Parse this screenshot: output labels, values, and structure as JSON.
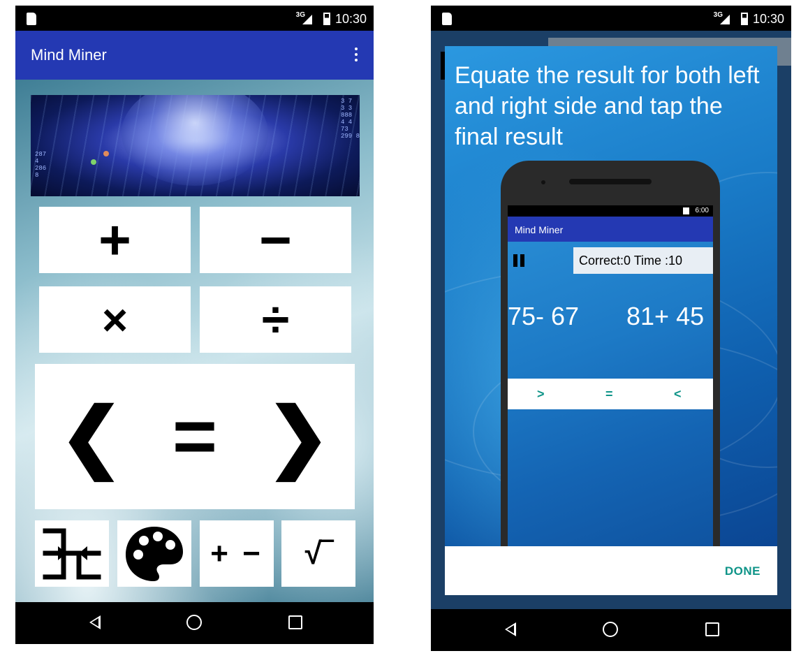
{
  "phone_left": {
    "status_bar": {
      "network": "3G",
      "time": "10:30"
    },
    "app_bar": {
      "title": "Mind Miner"
    },
    "operations": {
      "plus": "+",
      "minus": "−",
      "multiply": "×",
      "divide": "÷"
    },
    "compare": {
      "less": "❮",
      "equals": "=",
      "greater": "❯"
    },
    "tools": {
      "plus_minus": "+ −",
      "root": "√‾"
    }
  },
  "phone_right": {
    "status_bar": {
      "network": "3G",
      "time": "10:30"
    },
    "dialog": {
      "title": "Equate the result for both left and right side and tap the final result",
      "done_label": "DONE"
    },
    "mock": {
      "status_time": "6:00",
      "app_title": "Mind Miner",
      "score": "Correct:0  Time :10",
      "left_expression": "75- 67",
      "right_expression": "81+ 45",
      "compare": {
        "greater": ">",
        "equals": "=",
        "less": "<"
      }
    }
  }
}
